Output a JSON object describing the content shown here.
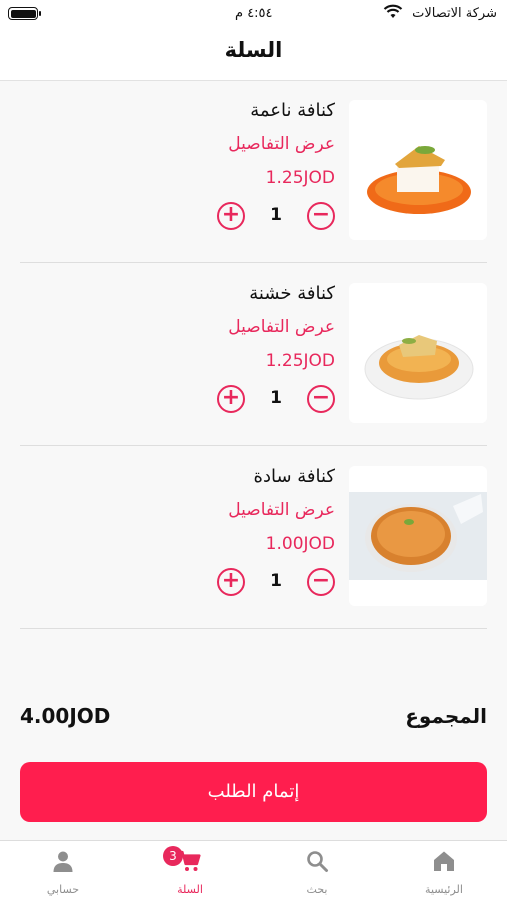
{
  "status_bar": {
    "carrier": "شركة الاتصالات",
    "time": "٤:٥٤ م"
  },
  "nav": {
    "title": "السلة"
  },
  "cart": {
    "items": [
      {
        "name": "كنافة ناعمة",
        "details_label": "عرض التفاصيل",
        "price": "1.25JOD",
        "quantity": "1",
        "image": "kunafa-naama-photo"
      },
      {
        "name": "كنافة خشنة",
        "details_label": "عرض التفاصيل",
        "price": "1.25JOD",
        "quantity": "1",
        "image": "kunafa-khishna-photo"
      },
      {
        "name": "كنافة سادة",
        "details_label": "عرض التفاصيل",
        "price": "1.00JOD",
        "quantity": "1",
        "image": "kunafa-sada-photo"
      }
    ],
    "minus_symbol": "−",
    "plus_symbol": "+"
  },
  "summary": {
    "total_label": "المجموع",
    "total_value": "4.00JOD"
  },
  "checkout_button": {
    "label": "إتمام الطلب"
  },
  "tabbar": {
    "tabs": [
      {
        "label": "الرئيسية",
        "icon": "home-icon"
      },
      {
        "label": "بحث",
        "icon": "search-icon"
      },
      {
        "label": "السلة",
        "icon": "cart-icon",
        "active": true
      },
      {
        "label": "حسابي",
        "icon": "account-icon"
      }
    ],
    "cart_badge": "3"
  },
  "colors": {
    "accent": "#e8285c",
    "button": "#ff1e4e"
  }
}
